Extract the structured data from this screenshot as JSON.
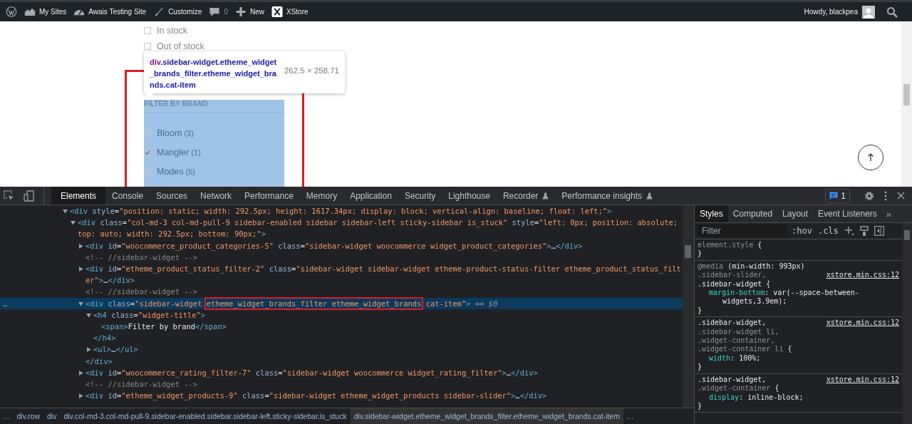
{
  "admin_bar": {
    "items": [
      {
        "kind": "wp-logo"
      },
      {
        "kind": "sites",
        "label": "My Sites"
      },
      {
        "kind": "site",
        "label": "Awais Testing Site"
      },
      {
        "kind": "customize",
        "label": "Customize"
      },
      {
        "kind": "comments",
        "label": "0"
      },
      {
        "kind": "new",
        "label": "New"
      },
      {
        "kind": "xstore",
        "label": "XStore"
      }
    ],
    "greeting": "Howdy, blackpea"
  },
  "page": {
    "stock_filters": [
      {
        "label": "In stock",
        "checked": false
      },
      {
        "label": "Out of stock",
        "checked": false
      }
    ],
    "inspect_tooltip": {
      "tag": "div",
      "classes": ".sidebar-widget.etheme_widget_brands_filter.etheme_widget_brands.cat-item",
      "size": "262.5 × 258.71"
    },
    "brand_widget": {
      "title": "FILTER BY BRAND",
      "brands": [
        {
          "name": "Bloom",
          "count": "(3)",
          "checked": false
        },
        {
          "name": "Mangler",
          "count": "(1)",
          "checked": true
        },
        {
          "name": "Modes",
          "count": "(5)",
          "checked": false
        }
      ]
    }
  },
  "devtools": {
    "tabs": [
      {
        "label": "Elements",
        "selected": true,
        "experimental": false
      },
      {
        "label": "Console",
        "selected": false,
        "experimental": false
      },
      {
        "label": "Sources",
        "selected": false,
        "experimental": false
      },
      {
        "label": "Network",
        "selected": false,
        "experimental": false
      },
      {
        "label": "Performance",
        "selected": false,
        "experimental": false
      },
      {
        "label": "Memory",
        "selected": false,
        "experimental": false
      },
      {
        "label": "Application",
        "selected": false,
        "experimental": false
      },
      {
        "label": "Security",
        "selected": false,
        "experimental": false
      },
      {
        "label": "Lighthouse",
        "selected": false,
        "experimental": false
      },
      {
        "label": "Recorder",
        "selected": false,
        "experimental": true
      },
      {
        "label": "Performance insights",
        "selected": false,
        "experimental": true
      }
    ],
    "issues_count": "1",
    "dom_tree": [
      {
        "kind": "element",
        "expanded": true,
        "selected": false,
        "parts": [
          {
            "kind": "tag",
            "text": "<div"
          },
          {
            "kind": "attr",
            "text": " style"
          },
          {
            "kind": "punct",
            "text": "="
          },
          {
            "kind": "value",
            "text": "\"position: static; width: 292.5px; height: 1617.34px; display: block; vertical-align: baseline; float: left;\""
          },
          {
            "kind": "tag",
            "text": ">"
          }
        ],
        "children": [
          {
            "kind": "element",
            "expanded": true,
            "selected": false,
            "parts": [
              {
                "kind": "tag",
                "text": "<div"
              },
              {
                "kind": "attr",
                "text": " class"
              },
              {
                "kind": "punct",
                "text": "="
              },
              {
                "kind": "value",
                "text": "\"col-md-3 col-md-pull-9 sidebar-enabled sidebar sidebar-left sticky-sidebar is_stuck\""
              },
              {
                "kind": "attr",
                "text": " style"
              },
              {
                "kind": "punct",
                "text": "="
              },
              {
                "kind": "value",
                "text": "\"left: 0px; position: absolute; top: auto; width: 292.5px; bottom: 90px;\""
              },
              {
                "kind": "tag",
                "text": ">"
              }
            ],
            "children": [
              {
                "kind": "element",
                "expanded": false,
                "selected": false,
                "parts": [
                  {
                    "kind": "tag",
                    "text": "<div"
                  },
                  {
                    "kind": "attr",
                    "text": " id"
                  },
                  {
                    "kind": "punct",
                    "text": "="
                  },
                  {
                    "kind": "value",
                    "text": "\"woocommerce_product_categories-5\""
                  },
                  {
                    "kind": "attr",
                    "text": " class"
                  },
                  {
                    "kind": "punct",
                    "text": "="
                  },
                  {
                    "kind": "value",
                    "text": "\"sidebar-widget woocommerce widget_product_categories\""
                  },
                  {
                    "kind": "tag",
                    "text": ">"
                  },
                  {
                    "kind": "text",
                    "text": "…"
                  },
                  {
                    "kind": "tag",
                    "text": "</div>"
                  }
                ]
              },
              {
                "kind": "comment",
                "selected": false,
                "parts": [
                  {
                    "kind": "comment",
                    "text": "<!-- //sidebar-widget -->"
                  }
                ]
              },
              {
                "kind": "element",
                "expanded": false,
                "selected": false,
                "parts": [
                  {
                    "kind": "tag",
                    "text": "<div"
                  },
                  {
                    "kind": "attr",
                    "text": " id"
                  },
                  {
                    "kind": "punct",
                    "text": "="
                  },
                  {
                    "kind": "value",
                    "text": "\"etheme_product_status_filter-2\""
                  },
                  {
                    "kind": "attr",
                    "text": " class"
                  },
                  {
                    "kind": "punct",
                    "text": "="
                  },
                  {
                    "kind": "value",
                    "text": "\"sidebar-widget sidebar-widget etheme-product-status-filter etheme_product_status_filter\""
                  },
                  {
                    "kind": "tag",
                    "text": ">"
                  },
                  {
                    "kind": "text",
                    "text": "…"
                  },
                  {
                    "kind": "tag",
                    "text": "</div>"
                  }
                ]
              },
              {
                "kind": "comment",
                "selected": false,
                "parts": [
                  {
                    "kind": "comment",
                    "text": "<!-- //sidebar-widget -->"
                  }
                ]
              },
              {
                "kind": "element",
                "expanded": true,
                "selected": true,
                "menu": "…",
                "parts": [
                  {
                    "kind": "tag",
                    "text": "<div"
                  },
                  {
                    "kind": "attr",
                    "text": " class"
                  },
                  {
                    "kind": "punct",
                    "text": "="
                  },
                  {
                    "kind": "value",
                    "text": "\"sidebar-widget "
                  },
                  {
                    "kind": "annotated",
                    "text": "etheme_widget_brands_filter etheme_widget_brands"
                  },
                  {
                    "kind": "value",
                    "text": " cat-item\""
                  },
                  {
                    "kind": "tag",
                    "text": ">"
                  },
                  {
                    "kind": "ref",
                    "text": " == $0"
                  }
                ],
                "children": [
                  {
                    "kind": "element",
                    "expanded": true,
                    "selected": false,
                    "parts": [
                      {
                        "kind": "tag",
                        "text": "<h4"
                      },
                      {
                        "kind": "attr",
                        "text": " class"
                      },
                      {
                        "kind": "punct",
                        "text": "="
                      },
                      {
                        "kind": "value",
                        "text": "\"widget-title\""
                      },
                      {
                        "kind": "tag",
                        "text": ">"
                      }
                    ],
                    "children": [
                      {
                        "kind": "text",
                        "selected": false,
                        "parts": [
                          {
                            "kind": "tag",
                            "text": "<span>"
                          },
                          {
                            "kind": "text",
                            "text": "Filter by brand"
                          },
                          {
                            "kind": "tag",
                            "text": "</span>"
                          }
                        ]
                      }
                    ]
                  },
                  {
                    "kind": "close",
                    "selected": false,
                    "parts": [
                      {
                        "kind": "tag",
                        "text": "</h4>"
                      }
                    ]
                  },
                  {
                    "kind": "element",
                    "expanded": false,
                    "selected": false,
                    "parts": [
                      {
                        "kind": "tag",
                        "text": "<ul>"
                      },
                      {
                        "kind": "text",
                        "text": "…"
                      },
                      {
                        "kind": "tag",
                        "text": "</ul>"
                      }
                    ]
                  }
                ]
              },
              {
                "kind": "close",
                "selected": false,
                "parts": [
                  {
                    "kind": "tag",
                    "text": "</div>"
                  }
                ]
              },
              {
                "kind": "element",
                "expanded": false,
                "selected": false,
                "parts": [
                  {
                    "kind": "tag",
                    "text": "<div"
                  },
                  {
                    "kind": "attr",
                    "text": " id"
                  },
                  {
                    "kind": "punct",
                    "text": "="
                  },
                  {
                    "kind": "value",
                    "text": "\"woocommerce_rating_filter-7\""
                  },
                  {
                    "kind": "attr",
                    "text": " class"
                  },
                  {
                    "kind": "punct",
                    "text": "="
                  },
                  {
                    "kind": "value",
                    "text": "\"sidebar-widget woocommerce widget_rating_filter\""
                  },
                  {
                    "kind": "tag",
                    "text": ">"
                  },
                  {
                    "kind": "text",
                    "text": "…"
                  },
                  {
                    "kind": "tag",
                    "text": "</div>"
                  }
                ]
              },
              {
                "kind": "comment",
                "selected": false,
                "parts": [
                  {
                    "kind": "comment",
                    "text": "<!-- //sidebar-widget -->"
                  }
                ]
              },
              {
                "kind": "element",
                "expanded": false,
                "selected": false,
                "parts": [
                  {
                    "kind": "tag",
                    "text": "<div"
                  },
                  {
                    "kind": "attr",
                    "text": " id"
                  },
                  {
                    "kind": "punct",
                    "text": "="
                  },
                  {
                    "kind": "value",
                    "text": "\"etheme_widget_products-9\""
                  },
                  {
                    "kind": "attr",
                    "text": " class"
                  },
                  {
                    "kind": "punct",
                    "text": "="
                  },
                  {
                    "kind": "value",
                    "text": "\"sidebar-widget etheme_widget_products sidebar-slider\""
                  },
                  {
                    "kind": "tag",
                    "text": ">"
                  },
                  {
                    "kind": "text",
                    "text": "…"
                  },
                  {
                    "kind": "tag",
                    "text": "</div>"
                  }
                ]
              }
            ]
          }
        ]
      }
    ],
    "breadcrumbs": [
      {
        "kind": "overflow",
        "label": "…",
        "selected": false
      },
      {
        "kind": "crumb",
        "label": "div.row",
        "selected": false
      },
      {
        "kind": "crumb",
        "label": "div",
        "selected": false
      },
      {
        "kind": "crumb",
        "label": "div.col-md-3.col-md-pull-9.sidebar-enabled.sidebar.sidebar-left.sticky-sidebar.is_stuck",
        "selected": false
      },
      {
        "kind": "crumb",
        "label": "div.sidebar-widget.etheme_widget_brands_filter.etheme_widget_brands.cat-item",
        "selected": true
      },
      {
        "kind": "overflow",
        "label": "…",
        "selected": false
      }
    ],
    "styles_pane": {
      "tabs": [
        {
          "label": "Styles",
          "selected": true
        },
        {
          "label": "Computed",
          "selected": false
        },
        {
          "label": "Layout",
          "selected": false
        },
        {
          "label": "Event Listeners",
          "selected": false
        }
      ],
      "more": "»",
      "filter_placeholder": "Filter",
      "toggles": [
        ":hov",
        ".cls"
      ],
      "rules": [
        {
          "selector": [
            {
              "text": "element.style ",
              "matched": false
            },
            {
              "text": "{",
              "matched": true
            }
          ],
          "close": "}"
        },
        {
          "media": {
            "keyword": "@media",
            "query": " (min-width: 993px)"
          },
          "source": "xstore.min.css:12",
          "selector": [
            {
              "text": ".sidebar-slider, ",
              "matched": false
            },
            {
              "text": ".sidebar-widget {",
              "matched": true
            }
          ],
          "declarations": [
            {
              "name": "margin-bottom",
              "value": ": var(--space-between-widgets,3.9em);"
            }
          ],
          "close": "}"
        },
        {
          "source": "xstore.min.css:12",
          "selector": [
            {
              "text": ".sidebar-widget, ",
              "matched": true
            },
            {
              "text": ".sidebar-widget li, ",
              "matched": false
            },
            {
              "text": ".widget-container, ",
              "matched": false
            },
            {
              "text": ".widget-container li ",
              "matched": false
            },
            {
              "text": "{",
              "matched": true
            }
          ],
          "declarations": [
            {
              "name": "width",
              "value": ": 100%;"
            }
          ],
          "close": "}"
        },
        {
          "source": "xstore.min.css:12",
          "selector": [
            {
              "text": ".sidebar-widget, ",
              "matched": true
            },
            {
              "text": ".widget-container ",
              "matched": false
            },
            {
              "text": "{",
              "matched": true
            }
          ],
          "declarations": [
            {
              "name": "display",
              "value": ": inline-block;"
            }
          ],
          "close": "}"
        }
      ]
    }
  }
}
